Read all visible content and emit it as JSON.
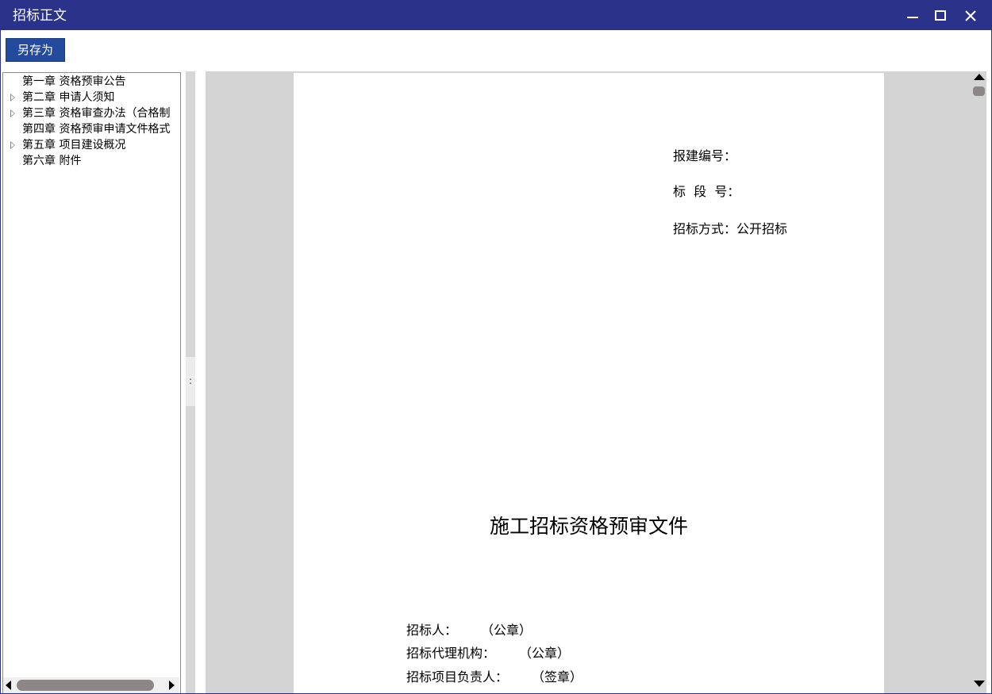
{
  "window": {
    "title": "招标正文",
    "accent_color": "#2b3289",
    "controls": {
      "minimize_icon": "minimize-icon",
      "maximize_icon": "maximize-icon",
      "close_icon": "close-icon"
    }
  },
  "toolbar": {
    "save_as_label": "另存为",
    "button_color": "#234a9c"
  },
  "tree": {
    "items": [
      {
        "label": "第一章 资格预审公告",
        "expandable": false
      },
      {
        "label": "第二章 申请人须知",
        "expandable": true
      },
      {
        "label": "第三章 资格审查办法（合格制",
        "expandable": true
      },
      {
        "label": "第四章 资格预审申请文件格式",
        "expandable": false
      },
      {
        "label": "第五章 项目建设概况",
        "expandable": true
      },
      {
        "label": "第六章 附件",
        "expandable": false
      }
    ]
  },
  "splitter": {
    "grip_glyph": ":"
  },
  "document": {
    "meta": [
      {
        "label": "报建编号："
      },
      {
        "label": "标  段  号："
      },
      {
        "label": "招标方式：公开招标"
      }
    ],
    "title": "施工招标资格预审文件",
    "signatures": [
      {
        "label": "招标人：",
        "note": "（公章）"
      },
      {
        "label": "招标代理机构：",
        "note": "（公章）"
      },
      {
        "label": "招标项目负责人：",
        "note": "（签章）"
      }
    ]
  }
}
